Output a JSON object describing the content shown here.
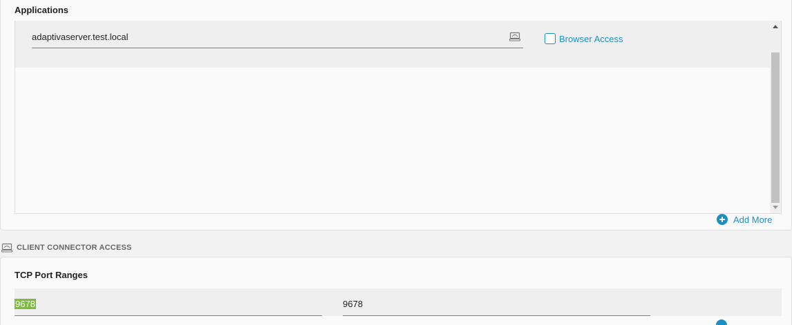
{
  "applications": {
    "title": "Applications",
    "items": [
      {
        "host": "adaptivaserver.test.local",
        "browser_access_label": "Browser Access",
        "browser_access_checked": false
      }
    ],
    "add_more_label": "Add More"
  },
  "client_connector": {
    "title": "CLIENT CONNECTOR ACCESS",
    "tcp_title": "TCP Port Ranges",
    "port_from": "9678",
    "port_to": "9678"
  },
  "colors": {
    "accent": "#1a8fc6",
    "underline": "#2aa19b",
    "selection": "#7bbd3b"
  }
}
